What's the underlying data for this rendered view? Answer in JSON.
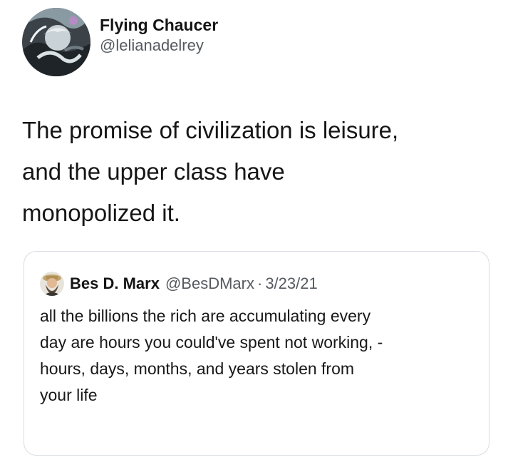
{
  "tweet": {
    "author": {
      "display_name": "Flying Chaucer",
      "handle": "@lelianadelrey",
      "avatar_icon": "profile-avatar-artwork"
    },
    "text_lines": [
      "The promise of civilization is leisure,",
      "and the upper class have",
      "monopolized it."
    ]
  },
  "quoted_tweet": {
    "author": {
      "display_name": "Bes D. Marx",
      "handle": "@BesDMarx",
      "avatar_icon": "profile-avatar-bearded-man"
    },
    "separator": "·",
    "date": "3/23/21",
    "text_lines": [
      "all the billions the rich are accumulating every",
      "day are hours you could've spent not working, -",
      "hours, days, months, and years stolen from",
      "your life"
    ]
  },
  "colors": {
    "name_text": "#141414",
    "secondary_text": "#555a60",
    "quote_border": "#d8dde1",
    "background": "#ffffff"
  }
}
